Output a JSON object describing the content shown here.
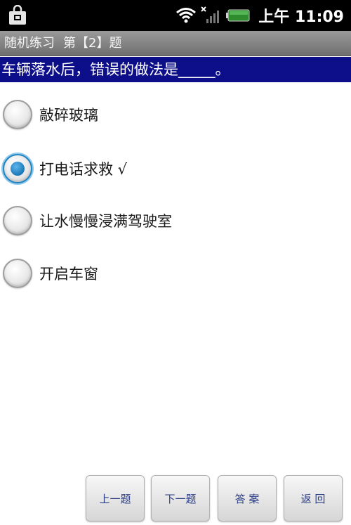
{
  "status_bar": {
    "time": "上午 11:09",
    "icons": [
      "shopping-bag-icon",
      "wifi-icon",
      "no-signal-icon",
      "battery-icon"
    ]
  },
  "title_bar": {
    "mode": "随机练习",
    "question_number": "第【2】题"
  },
  "question": {
    "text": "车辆落水后，错误的做法是_____。"
  },
  "options": [
    {
      "label": "敲碎玻璃",
      "selected": false
    },
    {
      "label": "打电话求救 √",
      "selected": true
    },
    {
      "label": "让水慢慢浸满驾驶室",
      "selected": false
    },
    {
      "label": "开启车窗",
      "selected": false
    }
  ],
  "buttons": {
    "prev": "上一题",
    "next": "下一题",
    "answer": "答 案",
    "back": "返 回"
  },
  "colors": {
    "question_bar": "#0d0f8a",
    "radio_selected": "#1e84c2",
    "button_text": "#2a3c86"
  }
}
